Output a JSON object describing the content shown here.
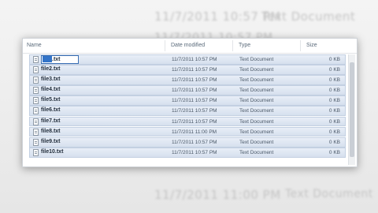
{
  "background": {
    "top_date": "11/7/2011 10:57 PM",
    "top_type": "Text Document",
    "second_line": "11/7/2011 10:57 PM",
    "bottom_date": "11/7/2011 11:00 PM",
    "bottom_type": "Text Document"
  },
  "explorer": {
    "columns": {
      "name": "Name",
      "date": "Date modified",
      "type": "Type",
      "size": "Size"
    },
    "rename_value": ".txt",
    "files": [
      {
        "name": "",
        "date": "11/7/2011 10:57 PM",
        "type": "Text Document",
        "size": "0 KB"
      },
      {
        "name": "file2.txt",
        "date": "11/7/2011 10:57 PM",
        "type": "Text Document",
        "size": "0 KB"
      },
      {
        "name": "file3.txt",
        "date": "11/7/2011 10:57 PM",
        "type": "Text Document",
        "size": "0 KB"
      },
      {
        "name": "file4.txt",
        "date": "11/7/2011 10:57 PM",
        "type": "Text Document",
        "size": "0 KB"
      },
      {
        "name": "file5.txt",
        "date": "11/7/2011 10:57 PM",
        "type": "Text Document",
        "size": "0 KB"
      },
      {
        "name": "file6.txt",
        "date": "11/7/2011 10:57 PM",
        "type": "Text Document",
        "size": "0 KB"
      },
      {
        "name": "file7.txt",
        "date": "11/7/2011 10:57 PM",
        "type": "Text Document",
        "size": "0 KB"
      },
      {
        "name": "file8.txt",
        "date": "11/7/2011 11:00 PM",
        "type": "Text Document",
        "size": "0 KB"
      },
      {
        "name": "file9.txt",
        "date": "11/7/2011 10:57 PM",
        "type": "Text Document",
        "size": "0 KB"
      },
      {
        "name": "file10.txt",
        "date": "11/7/2011 10:57 PM",
        "type": "Text Document",
        "size": "0 KB"
      }
    ]
  }
}
